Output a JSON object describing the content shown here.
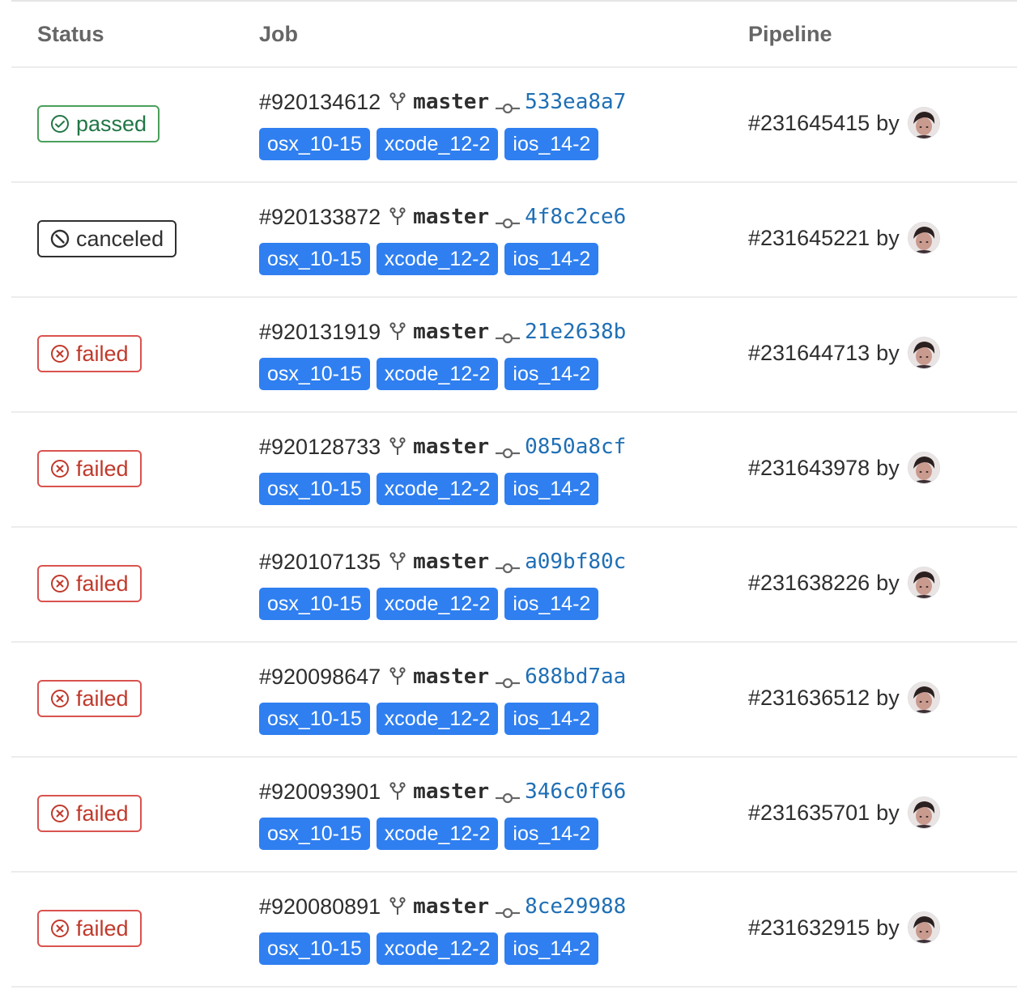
{
  "columns": {
    "status": "Status",
    "job": "Job",
    "pipeline": "Pipeline"
  },
  "colors": {
    "passed": "#217645",
    "canceled": "#303030",
    "failed": "#c0392b",
    "tag_bg": "#2f7ff0",
    "sha": "#1f6fb5"
  },
  "rows": [
    {
      "status": "passed",
      "status_icon": "check-circle-icon",
      "job_id": "#920134612",
      "branch": "master",
      "sha": "533ea8a7",
      "tags": [
        "osx_10-15",
        "xcode_12-2",
        "ios_14-2"
      ],
      "pipeline": "#231645415",
      "by": "by"
    },
    {
      "status": "canceled",
      "status_icon": "cancel-circle-icon",
      "job_id": "#920133872",
      "branch": "master",
      "sha": "4f8c2ce6",
      "tags": [
        "osx_10-15",
        "xcode_12-2",
        "ios_14-2"
      ],
      "pipeline": "#231645221",
      "by": "by"
    },
    {
      "status": "failed",
      "status_icon": "x-circle-icon",
      "job_id": "#920131919",
      "branch": "master",
      "sha": "21e2638b",
      "tags": [
        "osx_10-15",
        "xcode_12-2",
        "ios_14-2"
      ],
      "pipeline": "#231644713",
      "by": "by"
    },
    {
      "status": "failed",
      "status_icon": "x-circle-icon",
      "job_id": "#920128733",
      "branch": "master",
      "sha": "0850a8cf",
      "tags": [
        "osx_10-15",
        "xcode_12-2",
        "ios_14-2"
      ],
      "pipeline": "#231643978",
      "by": "by"
    },
    {
      "status": "failed",
      "status_icon": "x-circle-icon",
      "job_id": "#920107135",
      "branch": "master",
      "sha": "a09bf80c",
      "tags": [
        "osx_10-15",
        "xcode_12-2",
        "ios_14-2"
      ],
      "pipeline": "#231638226",
      "by": "by"
    },
    {
      "status": "failed",
      "status_icon": "x-circle-icon",
      "job_id": "#920098647",
      "branch": "master",
      "sha": "688bd7aa",
      "tags": [
        "osx_10-15",
        "xcode_12-2",
        "ios_14-2"
      ],
      "pipeline": "#231636512",
      "by": "by"
    },
    {
      "status": "failed",
      "status_icon": "x-circle-icon",
      "job_id": "#920093901",
      "branch": "master",
      "sha": "346c0f66",
      "tags": [
        "osx_10-15",
        "xcode_12-2",
        "ios_14-2"
      ],
      "pipeline": "#231635701",
      "by": "by"
    },
    {
      "status": "failed",
      "status_icon": "x-circle-icon",
      "job_id": "#920080891",
      "branch": "master",
      "sha": "8ce29988",
      "tags": [
        "osx_10-15",
        "xcode_12-2",
        "ios_14-2"
      ],
      "pipeline": "#231632915",
      "by": "by"
    }
  ]
}
